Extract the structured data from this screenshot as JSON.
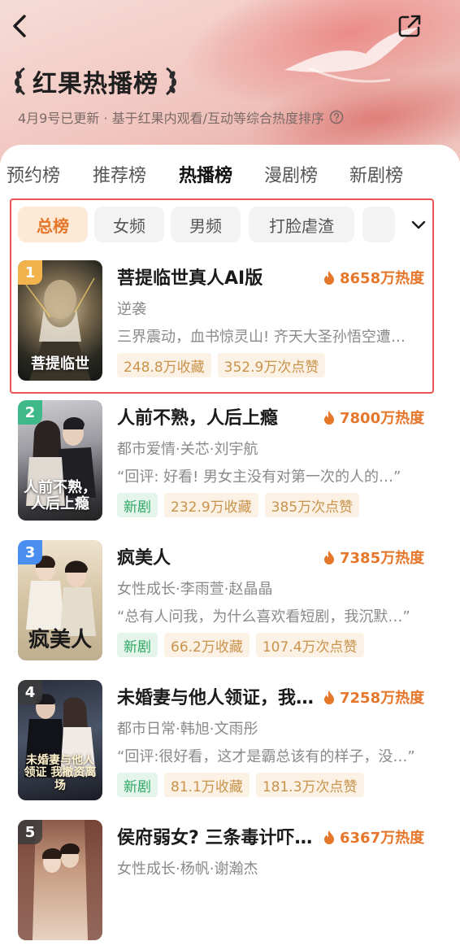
{
  "header": {
    "title": "红果热播榜",
    "subtitle": "4月9号已更新 · 基于红果内观看/互动等综合热度排序"
  },
  "tabs": [
    {
      "label": "预约榜",
      "active": false
    },
    {
      "label": "推荐榜",
      "active": false
    },
    {
      "label": "热播榜",
      "active": true
    },
    {
      "label": "漫剧榜",
      "active": false
    },
    {
      "label": "新剧榜",
      "active": false
    }
  ],
  "chips": [
    {
      "label": "总榜",
      "active": true
    },
    {
      "label": "女频",
      "active": false
    },
    {
      "label": "男频",
      "active": false
    },
    {
      "label": "打脸虐渣",
      "active": false
    }
  ],
  "colors": {
    "accent": "#e5762a",
    "rank1": "#f2b24c",
    "rank2": "#3fb98a",
    "rank3": "#4a8ff0",
    "rank_default": "#8a8a8a",
    "new_tag": "#2ea863",
    "highlight_border": "#e55555"
  },
  "icons": {
    "back": "chevron-left-icon",
    "share": "share-icon",
    "help": "question-circle-icon",
    "expand": "chevron-down-icon",
    "heat": "flame-icon",
    "laurel": "laurel-icon"
  },
  "items": [
    {
      "rank": "1",
      "title": "菩提临世真人AI版",
      "heat": "8658万热度",
      "genre": "逆袭",
      "desc": "三界震动，血书惊灵山! 齐天大圣孙悟空遭…",
      "tags": [
        "248.8万收藏",
        "352.9万次点赞"
      ],
      "is_new": false,
      "poster_text": "菩提临世",
      "new_label": ""
    },
    {
      "rank": "2",
      "title": "人前不熟，人后上瘾",
      "heat": "7800万热度",
      "genre": "都市爱情·关芯·刘宇航",
      "desc": "“回评: 好看! 男女主没有对第一次的人的…”",
      "tags": [
        "232.9万收藏",
        "385万次点赞"
      ],
      "is_new": true,
      "new_label": "新剧",
      "poster_text": "人前不熟，人后上瘾"
    },
    {
      "rank": "3",
      "title": "疯美人",
      "heat": "7385万热度",
      "genre": "女性成长·李雨萱·赵晶晶",
      "desc": "“总有人问我，为什么喜欢看短剧，我沉默…”",
      "tags": [
        "66.2万收藏",
        "107.4万次点赞"
      ],
      "is_new": true,
      "new_label": "新剧",
      "poster_text": "疯美人"
    },
    {
      "rank": "4",
      "title": "未婚妻与他人领证，我…",
      "heat": "7258万热度",
      "genre": "都市日常·韩旭·文雨彤",
      "desc": "“回评:很好看，这才是霸总该有的样子，没…”",
      "tags": [
        "81.1万收藏",
        "181.3万次点赞"
      ],
      "is_new": true,
      "new_label": "新剧",
      "poster_text": "未婚妻与他人领证 我撤资离场"
    },
    {
      "rank": "5",
      "title": "侯府弱女? 三条毒计吓…",
      "heat": "6367万热度",
      "genre": "女性成长·杨帆·谢瀚杰",
      "desc": "",
      "tags": [],
      "is_new": false,
      "new_label": "",
      "poster_text": ""
    }
  ]
}
